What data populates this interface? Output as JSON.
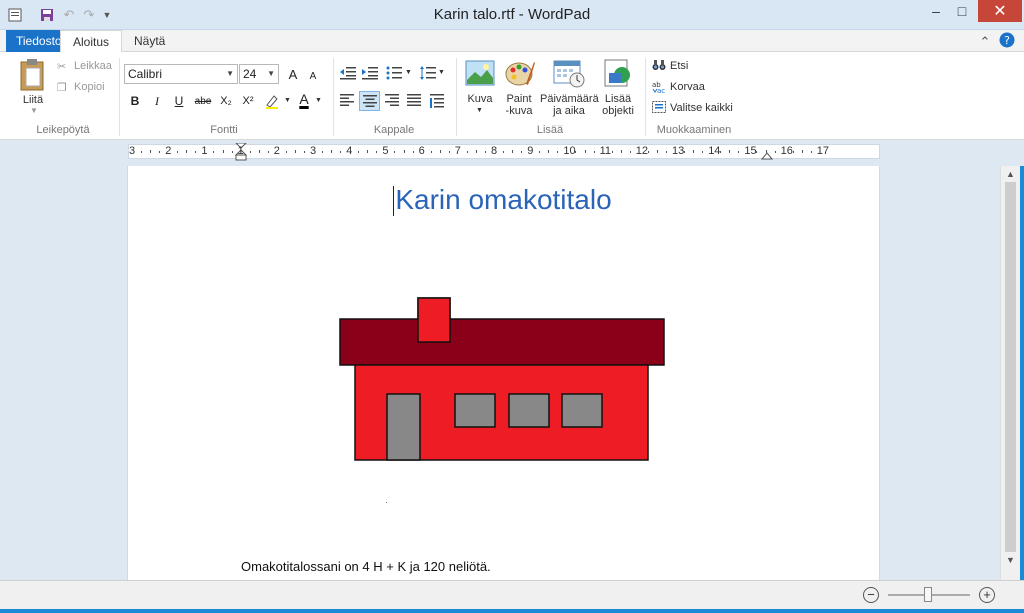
{
  "window": {
    "title": "Karin talo.rtf - WordPad",
    "minimize": "–",
    "maximize": "□",
    "close": "✕"
  },
  "tabs": {
    "file": "Tiedosto",
    "home": "Aloitus",
    "view": "Näytä"
  },
  "ribbon": {
    "clipboard": {
      "label": "Leikepöytä",
      "paste": "Liitä",
      "cut": "Leikkaa",
      "copy": "Kopioi"
    },
    "font": {
      "label": "Fontti",
      "family": "Calibri",
      "size": "24",
      "bold": "B",
      "italic": "I",
      "underline": "U",
      "strike": "abe",
      "subscript": "X₂",
      "superscript": "X²",
      "grow": "A",
      "shrink": "A",
      "text_color": "A"
    },
    "paragraph": {
      "label": "Kappale"
    },
    "insert": {
      "label": "Lisää",
      "picture": "Kuva",
      "paint_line1": "Paint",
      "paint_line2": "-kuva",
      "datetime_line1": "Päivämäärä",
      "datetime_line2": "ja aika",
      "object_line1": "Lisää",
      "object_line2": "objekti"
    },
    "editing": {
      "label": "Muokkaaminen",
      "find": "Etsi",
      "replace": "Korvaa",
      "select_all": "Valitse kaikki"
    }
  },
  "ruler": {
    "labels": [
      "3",
      "2",
      "1",
      "1",
      "2",
      "3",
      "4",
      "5",
      "6",
      "7",
      "8",
      "9",
      "10",
      "11",
      "12",
      "13",
      "14",
      "15",
      "16",
      "17"
    ]
  },
  "document": {
    "title": "Karin omakotitalo",
    "body": "Omakotitalossani on 4 H + K ja 120 neliötä.",
    "colors": {
      "title": "#2a64b8",
      "roof": "#8a0018",
      "wall": "#ee1c24",
      "door": "#888888",
      "window": "#888888"
    }
  },
  "colors": {
    "accent": "#1a73c9",
    "close": "#c7463a"
  }
}
